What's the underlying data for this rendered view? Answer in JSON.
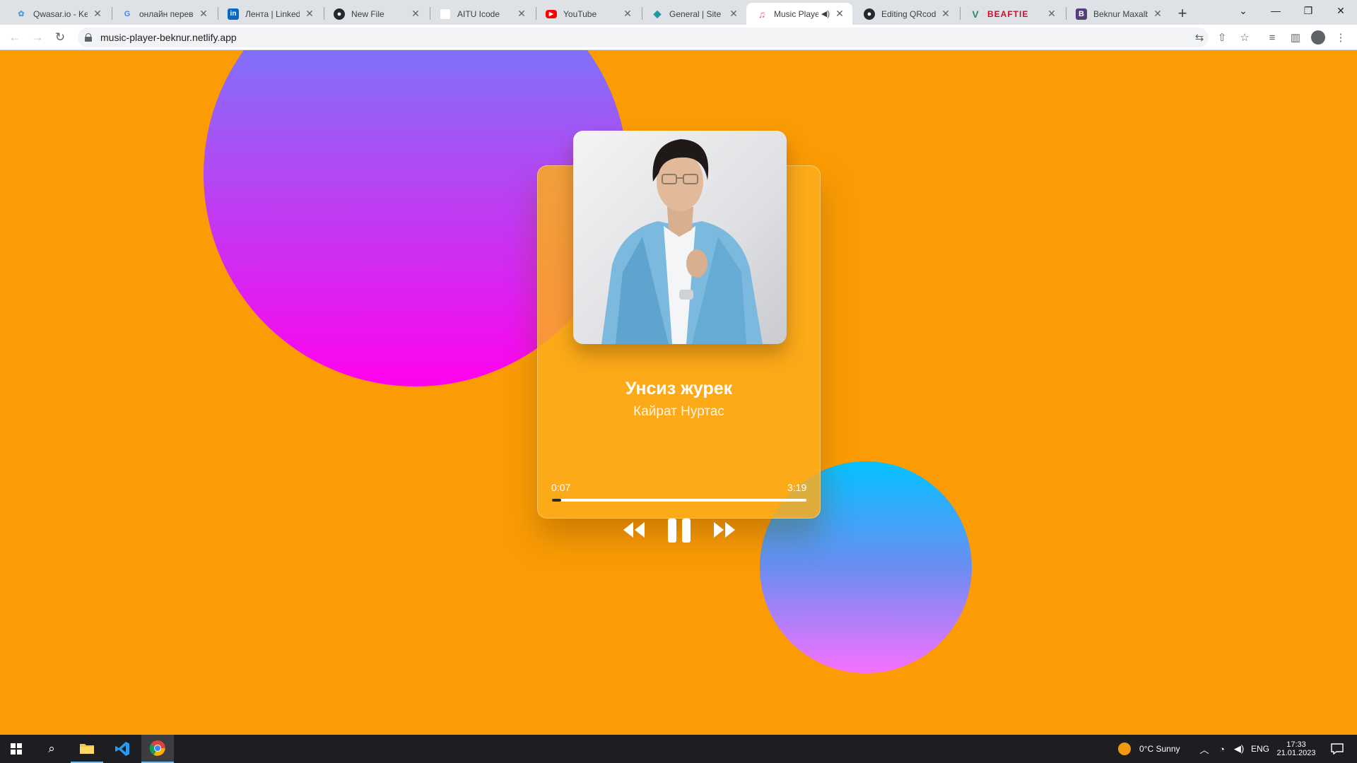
{
  "browser": {
    "tabs": [
      {
        "title": "Qwasar.io - Kee",
        "icon": "qwasar-icon",
        "active": false
      },
      {
        "title": "онлайн перевод",
        "icon": "google-icon",
        "active": false
      },
      {
        "title": "Лента | LinkedIn",
        "icon": "linkedin-icon",
        "active": false
      },
      {
        "title": "New File",
        "icon": "github-icon",
        "active": false
      },
      {
        "title": "AITU Icode",
        "icon": "blank-page-icon",
        "active": false
      },
      {
        "title": "YouTube",
        "icon": "youtube-icon",
        "active": false
      },
      {
        "title": "General | Site se",
        "icon": "diamond-icon",
        "active": false
      },
      {
        "title": "Music Playe",
        "icon": "music-note-icon",
        "active": true,
        "muted_indicator": true
      },
      {
        "title": "Editing QRcode",
        "icon": "github-icon",
        "active": false
      },
      {
        "title": "BEAFTIE",
        "icon": "vue-icon",
        "active": false
      },
      {
        "title": "Beknur Maxalba",
        "icon": "bootstrap-icon",
        "active": false
      }
    ],
    "url": "music-player-beknur.netlify.app"
  },
  "player": {
    "title": "Унсиз журек",
    "artist": "Кайрат Нуртас",
    "current_time": "0:07",
    "duration": "3:19",
    "progress_fraction": 0.035,
    "accent_color": "#fb9c04"
  },
  "taskbar": {
    "weather": "0°C  Sunny",
    "language": "ENG",
    "time": "17:33",
    "date": "21.01.2023"
  }
}
